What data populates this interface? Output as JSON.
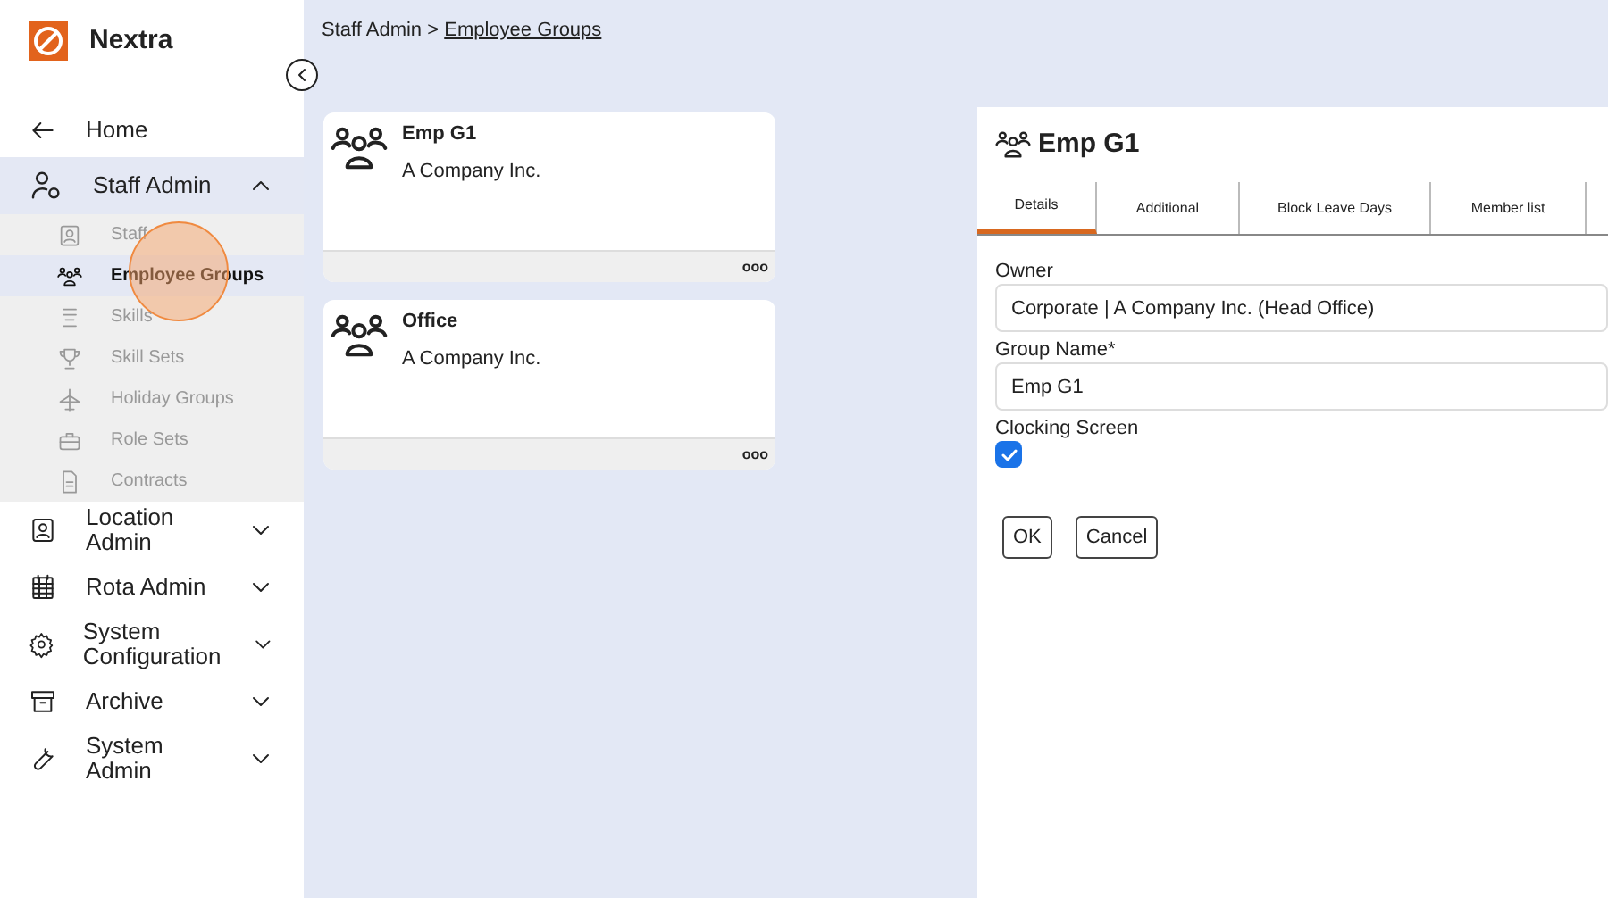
{
  "app": {
    "name": "Nextra"
  },
  "sidebar": {
    "items": [
      {
        "kind": "link",
        "label": "Home"
      },
      {
        "kind": "group",
        "label": "Staff Admin",
        "expanded": true,
        "children": [
          {
            "label": "Staff",
            "selected": false
          },
          {
            "label": "Employee Groups",
            "selected": true
          },
          {
            "label": "Skills",
            "selected": false
          },
          {
            "label": "Skill Sets",
            "selected": false
          },
          {
            "label": "Holiday Groups",
            "selected": false
          },
          {
            "label": "Role Sets",
            "selected": false
          },
          {
            "label": "Contracts",
            "selected": false
          }
        ]
      },
      {
        "kind": "group",
        "label": "Location Admin",
        "expanded": false
      },
      {
        "kind": "group",
        "label": "Rota Admin",
        "expanded": false
      },
      {
        "kind": "group",
        "label": "System Configuration",
        "expanded": false
      },
      {
        "kind": "group",
        "label": "Archive",
        "expanded": false
      },
      {
        "kind": "group",
        "label": "System Admin",
        "expanded": false
      }
    ]
  },
  "breadcrumb": {
    "parent": "Staff Admin",
    "separator": ">",
    "current": "Employee Groups"
  },
  "cards": [
    {
      "title": "Emp G1",
      "subtitle": "A Company Inc.",
      "menu": "ooo"
    },
    {
      "title": "Office",
      "subtitle": "A Company Inc.",
      "menu": "ooo"
    }
  ],
  "detail": {
    "title": "Emp G1",
    "tabs": [
      {
        "label": "Details",
        "selected": true
      },
      {
        "label": "Additional",
        "selected": false
      },
      {
        "label": "Block Leave Days",
        "selected": false
      },
      {
        "label": "Member list",
        "selected": false
      }
    ],
    "fields": [
      {
        "kind": "text",
        "label": "Owner",
        "value": "Corporate | A Company Inc. (Head Office)"
      },
      {
        "kind": "text",
        "label": "Group Name*",
        "value": "Emp G1"
      },
      {
        "kind": "checkbox",
        "label": "Clocking Screen",
        "checked": true
      }
    ],
    "buttons": [
      "OK",
      "Cancel"
    ]
  }
}
